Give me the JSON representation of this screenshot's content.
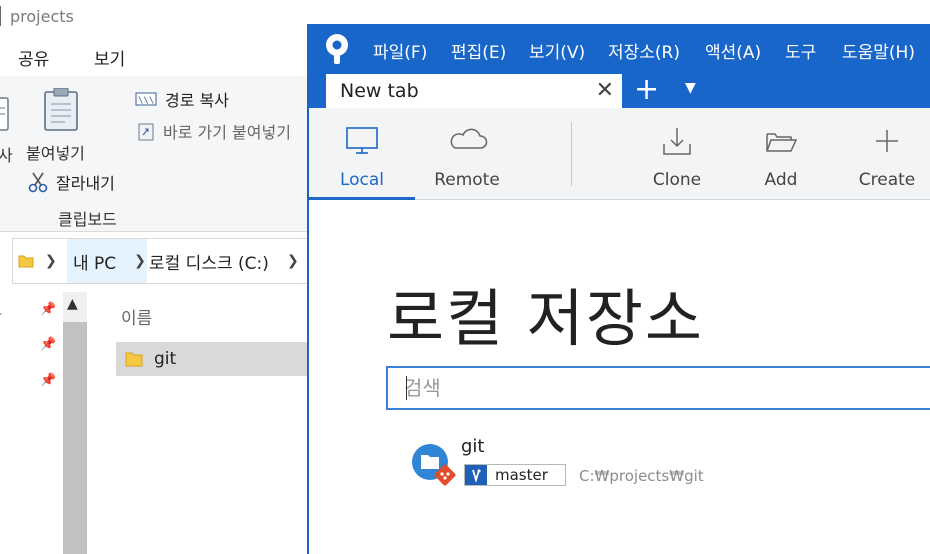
{
  "explorer": {
    "title": "projects",
    "menu": [
      "공유",
      "보기"
    ],
    "ribbon": {
      "paste_label": "붙여넣기",
      "left_partial_label": "사",
      "copy_path": "경로 복사",
      "paste_shortcut": "바로 가기 붙여넣기",
      "cut": "잘라내기",
      "group_label": "클립보드"
    },
    "address": {
      "this_pc": "내 PC",
      "drive": "로컬 디스크 (C:)"
    },
    "column_name": "이름",
    "files": [
      {
        "name": "git"
      }
    ]
  },
  "sourcetree": {
    "menu": [
      "파일(F)",
      "편집(E)",
      "보기(V)",
      "저장소(R)",
      "액션(A)",
      "도구",
      "도움말(H)"
    ],
    "tab": {
      "label": "New tab"
    },
    "toolbar": {
      "local": "Local",
      "remote": "Remote",
      "clone": "Clone",
      "add": "Add",
      "create": "Create"
    },
    "heading": "로컬 저장소",
    "search": {
      "placeholder": "검색"
    },
    "repos": [
      {
        "name": "git",
        "branch": "master",
        "path": "C:₩projects₩git"
      }
    ],
    "colors": {
      "accent": "#1866c9",
      "branch_badge": "#1f5fb7",
      "git_diamond": "#e24b2b"
    }
  }
}
